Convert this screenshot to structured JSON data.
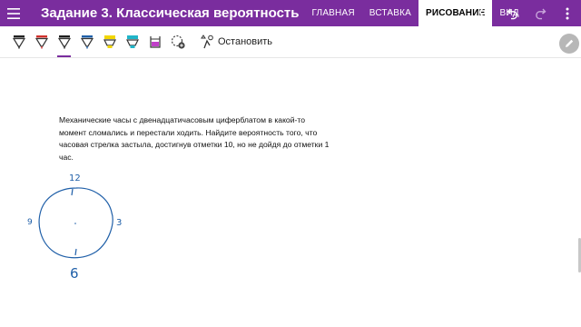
{
  "app": {
    "document_title": "Задание 3. Классическая вероятность"
  },
  "tabs": [
    {
      "label": "ГЛАВНАЯ",
      "active": false
    },
    {
      "label": "ВСТАВКА",
      "active": false
    },
    {
      "label": "РИСОВАНИЕ",
      "active": true
    },
    {
      "label": "ВИД",
      "active": false
    }
  ],
  "title_icons": [
    "menu-icon",
    "search-icon",
    "undo-icon",
    "redo-icon",
    "more-icon"
  ],
  "ribbon": {
    "tools": [
      {
        "name": "pen-black",
        "color": "#222222"
      },
      {
        "name": "pen-red",
        "color": "#d0312d"
      },
      {
        "name": "pen-dark",
        "color": "#1e1e1e",
        "selected": true
      },
      {
        "name": "pen-blue",
        "color": "#1f5fa8"
      },
      {
        "name": "highlighter-yellow",
        "color": "#f2d600"
      },
      {
        "name": "highlighter-cyan",
        "color": "#20b5c8"
      },
      {
        "name": "highlighter-purple",
        "color": "#c03fc8"
      },
      {
        "name": "lasso-add",
        "color": "#444444"
      }
    ],
    "stop_label": "Остановить"
  },
  "colors": {
    "accent": "#7a2d9e",
    "ink_blue": "#1f5fa8"
  },
  "content": {
    "problem_text": "Механические часы с двенадцатичасовым циферблатом в какой-то момент сломались и перестали ходить. Найдите вероятность того, что часовая стрелка застыла, достигнув отметки 10, но не дойдя до отметки 1 час.",
    "clock_labels": {
      "top": "12",
      "right": "3",
      "bottom": "6",
      "left": "9"
    }
  }
}
